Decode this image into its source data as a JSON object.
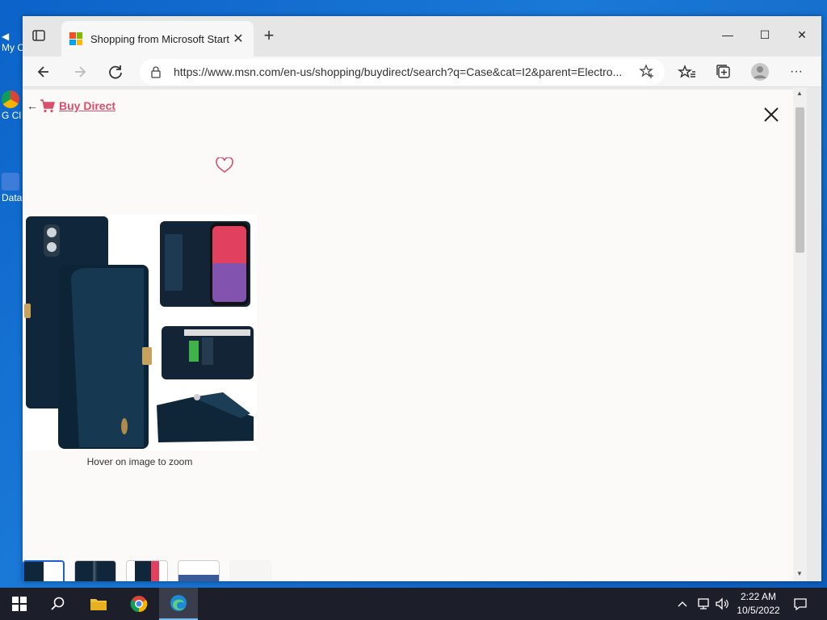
{
  "desktop": {
    "icons": [
      {
        "label": "My C"
      },
      {
        "label": "G Cl"
      },
      {
        "label": "Data"
      }
    ]
  },
  "browser": {
    "tab_title": "Shopping from Microsoft Start",
    "tab_close": "✕",
    "new_tab": "+",
    "window_controls": {
      "minimize": "—",
      "maximize": "☐",
      "close": "✕"
    },
    "url": "https://www.msn.com/en-us/shopping/buydirect/search?q=Case&cat=I2&parent=Electro...",
    "more": "···"
  },
  "page": {
    "back": "←",
    "buy_direct": "Buy Direct",
    "zoom_hint": "Hover on image to zoom"
  },
  "taskbar": {
    "time": "2:22 AM",
    "date": "10/5/2022"
  },
  "colors": {
    "accent": "#d94e6b",
    "taskbar": "#1c1f2a",
    "desktop": "#0b63c9"
  }
}
